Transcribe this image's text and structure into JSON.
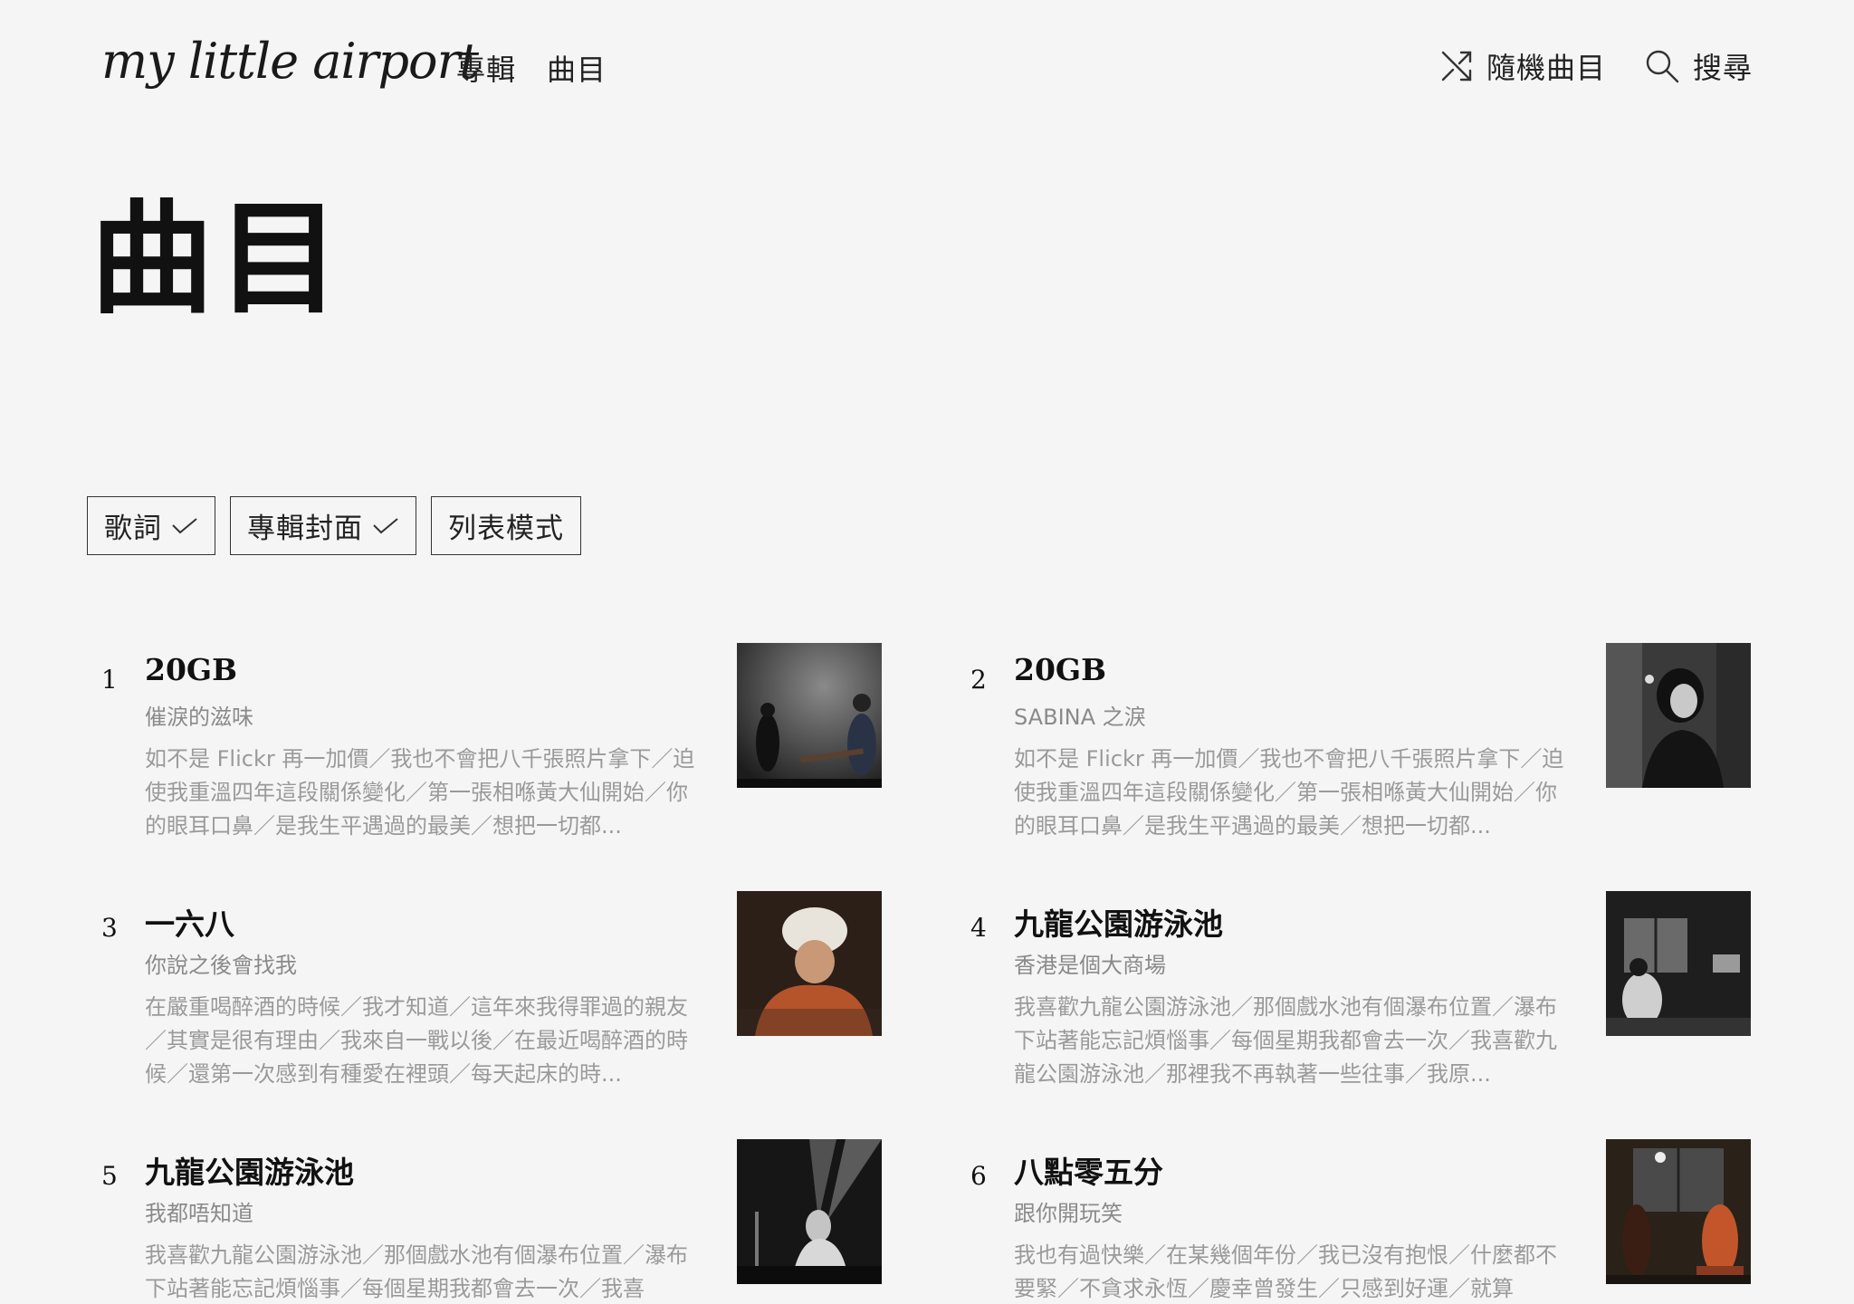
{
  "header": {
    "logo": "my little airport",
    "nav": [
      "專輯",
      "曲目"
    ],
    "shuffle_label": "隨機曲目",
    "search_label": "搜尋"
  },
  "page_title": "曲目",
  "filters": [
    {
      "label": "歌詞",
      "checked": true
    },
    {
      "label": "專輯封面",
      "checked": true
    },
    {
      "label": "列表模式",
      "checked": false
    }
  ],
  "songs": [
    {
      "num": "1",
      "title": "20GB",
      "album": "催淚的滋味",
      "lyrics": "如不是 Flickr 再一加價／我也不會把八千張照片拿下／迫使我重溫四年這段關係變化／第一張相喺黃大仙開始／你的眼耳口鼻／是我生平遇過的最美／想把一切都..."
    },
    {
      "num": "2",
      "title": "20GB",
      "album": "SABINA 之淚",
      "lyrics": "如不是 Flickr 再一加價／我也不會把八千張照片拿下／迫使我重溫四年這段關係變化／第一張相喺黃大仙開始／你的眼耳口鼻／是我生平遇過的最美／想把一切都..."
    },
    {
      "num": "3",
      "title": "一六八",
      "album": "你說之後會找我",
      "lyrics": "在嚴重喝醉酒的時候／我才知道／這年來我得罪過的親友／其實是很有理由／我來自一戰以後／在最近喝醉酒的時候／還第一次感到有種愛在裡頭／每天起床的時..."
    },
    {
      "num": "4",
      "title": "九龍公園游泳池",
      "album": "香港是個大商場",
      "lyrics": "我喜歡九龍公園游泳池／那個戲水池有個瀑布位置／瀑布下站著能忘記煩惱事／每個星期我都會去一次／我喜歡九龍公園游泳池／那裡我不再執著一些往事／我原..."
    },
    {
      "num": "5",
      "title": "九龍公園游泳池",
      "album": "我都唔知道",
      "lyrics": "我喜歡九龍公園游泳池／那個戲水池有個瀑布位置／瀑布下站著能忘記煩惱事／每個星期我都會去一次／我喜"
    },
    {
      "num": "6",
      "title": "八點零五分",
      "album": "跟你開玩笑",
      "lyrics": "我也有過快樂／在某幾個年份／我已沒有抱恨／什麼都不要緊／不貪求永恆／慶幸曾發生／只感到好運／就算"
    }
  ]
}
